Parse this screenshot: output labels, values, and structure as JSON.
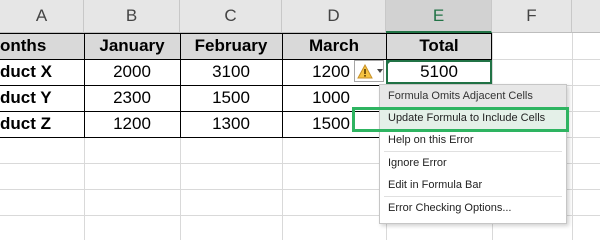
{
  "columns": [
    "A",
    "B",
    "C",
    "D",
    "E",
    "F"
  ],
  "selected_column": "E",
  "header_row": [
    "onths",
    "January",
    "February",
    "March",
    "Total"
  ],
  "rows": [
    {
      "label": "duct X",
      "january": "2000",
      "february": "3100",
      "march": "1200",
      "total": "5100"
    },
    {
      "label": "duct Y",
      "january": "2300",
      "february": "1500",
      "march": "1000",
      "total": ""
    },
    {
      "label": "duct Z",
      "january": "1200",
      "february": "1300",
      "march": "1500",
      "total": ""
    }
  ],
  "error_menu": {
    "title": "Formula Omits Adjacent Cells",
    "items": [
      {
        "label": "Update Formula to Include Cells",
        "highlighted": true
      },
      {
        "label": "Help on this Error"
      },
      {
        "label": "Ignore Error"
      },
      {
        "label": "Edit in Formula Bar"
      },
      {
        "label": "Error Checking Options..."
      }
    ]
  },
  "icons": {
    "error_tag": "warning-icon",
    "tag_dropdown": "chevron-down-icon"
  },
  "colors": {
    "accent_green": "#217346",
    "highlight_border": "#2eb461",
    "header_fill": "#d9d9d9"
  }
}
